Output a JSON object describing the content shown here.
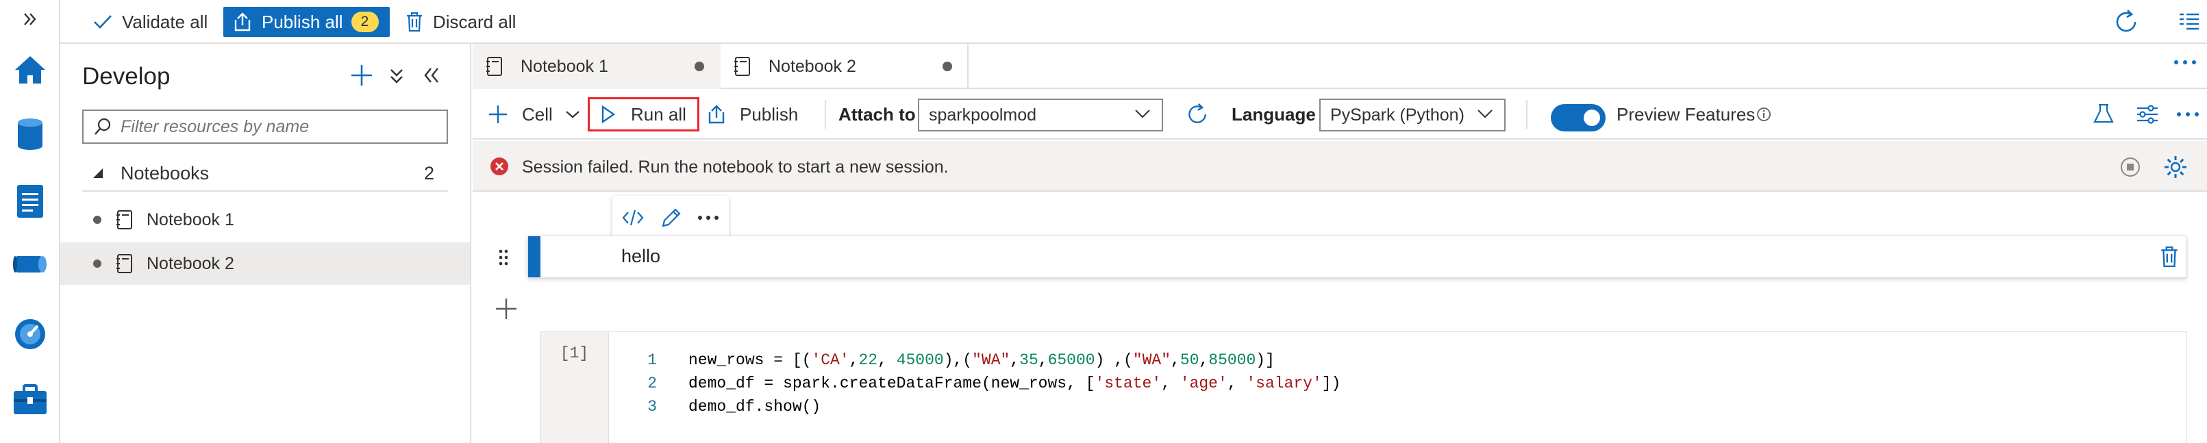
{
  "topbar": {
    "validate_label": "Validate all",
    "publish_label": "Publish all",
    "publish_count": "2",
    "discard_label": "Discard all"
  },
  "develop": {
    "title": "Develop",
    "filter_placeholder": "Filter resources by name",
    "section_label": "Notebooks",
    "section_count": "2",
    "items": [
      {
        "label": "Notebook 1"
      },
      {
        "label": "Notebook 2"
      }
    ]
  },
  "tabs": [
    {
      "label": "Notebook 1"
    },
    {
      "label": "Notebook 2"
    }
  ],
  "toolbar": {
    "cell_label": "Cell",
    "run_all_label": "Run all",
    "publish_label": "Publish",
    "attach_label": "Attach to",
    "attach_value": "sparkpoolmod",
    "language_label": "Language",
    "language_value": "PySpark (Python)",
    "preview_label": "Preview Features"
  },
  "message": {
    "text": "Session failed. Run the notebook to start a new session."
  },
  "markdown_cell": {
    "text": "hello"
  },
  "code_cell": {
    "execution_count": "[1]",
    "line_numbers": [
      "1",
      "2",
      "3"
    ]
  },
  "colors": {
    "accent": "#0f6cbd",
    "error": "#d13438",
    "run_all_highlight": "#e8252a",
    "badge": "#ffd94f"
  },
  "icons": [
    "chevron-double-right-icon",
    "home-icon",
    "database-icon",
    "document-icon",
    "pipeline-icon",
    "monitor-icon",
    "toolbox-icon",
    "checkmark-icon",
    "upload-icon",
    "trash-icon",
    "refresh-icon",
    "list-icon",
    "plus-icon",
    "collapse-all-icon",
    "double-chevron-left-icon",
    "search-icon",
    "notebook-icon",
    "play-icon",
    "info-icon",
    "error-icon",
    "stop-icon",
    "gear-icon",
    "code-icon",
    "pencil-icon",
    "more-icon",
    "drag-handle-icon"
  ]
}
